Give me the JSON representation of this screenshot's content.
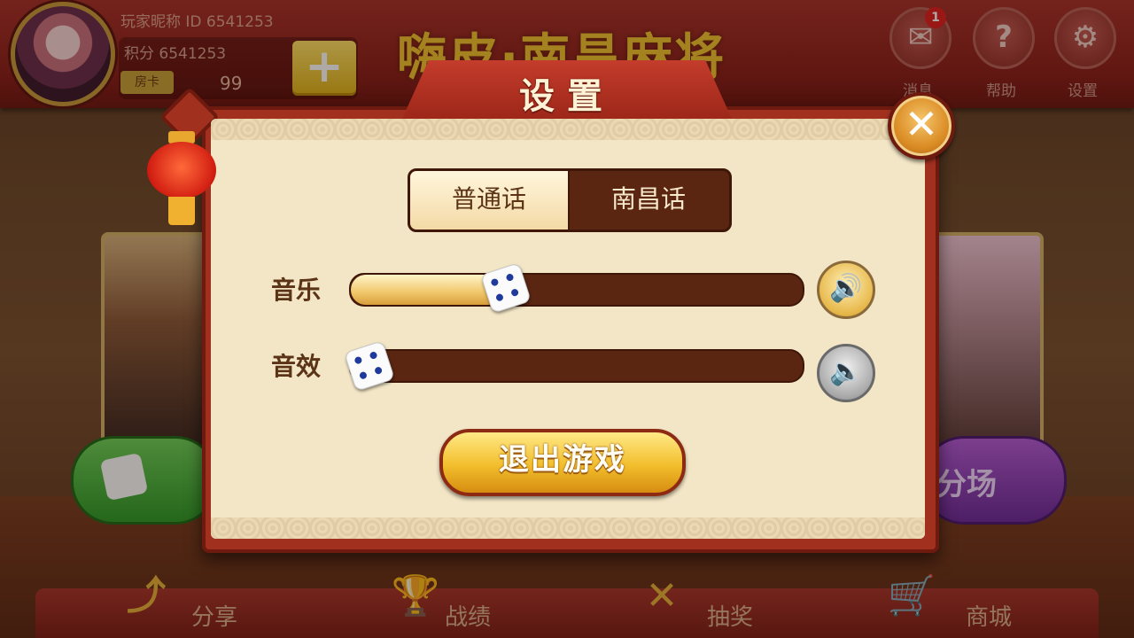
{
  "header": {
    "player_name_id": "玩家昵称  ID 6541253",
    "score": "积分 6541253",
    "card_label": "房卡",
    "card_count": "99",
    "add_button": "+",
    "game_title": "嗨皮·南昌麻将",
    "mail_label": "消息",
    "mail_badge": "1",
    "help_label": "帮助",
    "settings_label": "设置"
  },
  "background_modes": {
    "right_mode_label": "分场"
  },
  "bottom_nav": [
    {
      "label": "分享",
      "icon": "share-icon"
    },
    {
      "label": "战绩",
      "icon": "trophy-icon"
    },
    {
      "label": "抽奖",
      "icon": "lottery-icon"
    },
    {
      "label": "商城",
      "icon": "cart-icon"
    }
  ],
  "dialog": {
    "title": "设置",
    "close_glyph": "✕",
    "language_options": [
      "普通话",
      "南昌话"
    ],
    "selected_language": "普通话",
    "music_label": "音乐",
    "music_level": 0.33,
    "music_muted": false,
    "sfx_label": "音效",
    "sfx_level": 0.0,
    "sfx_muted": true,
    "exit_button": "退出游戏"
  },
  "colors": {
    "panel_bg": "#f3e6c6",
    "frame_red": "#a1301f",
    "slider_track": "#5a2612",
    "exit_gold": "#f2be2c"
  }
}
